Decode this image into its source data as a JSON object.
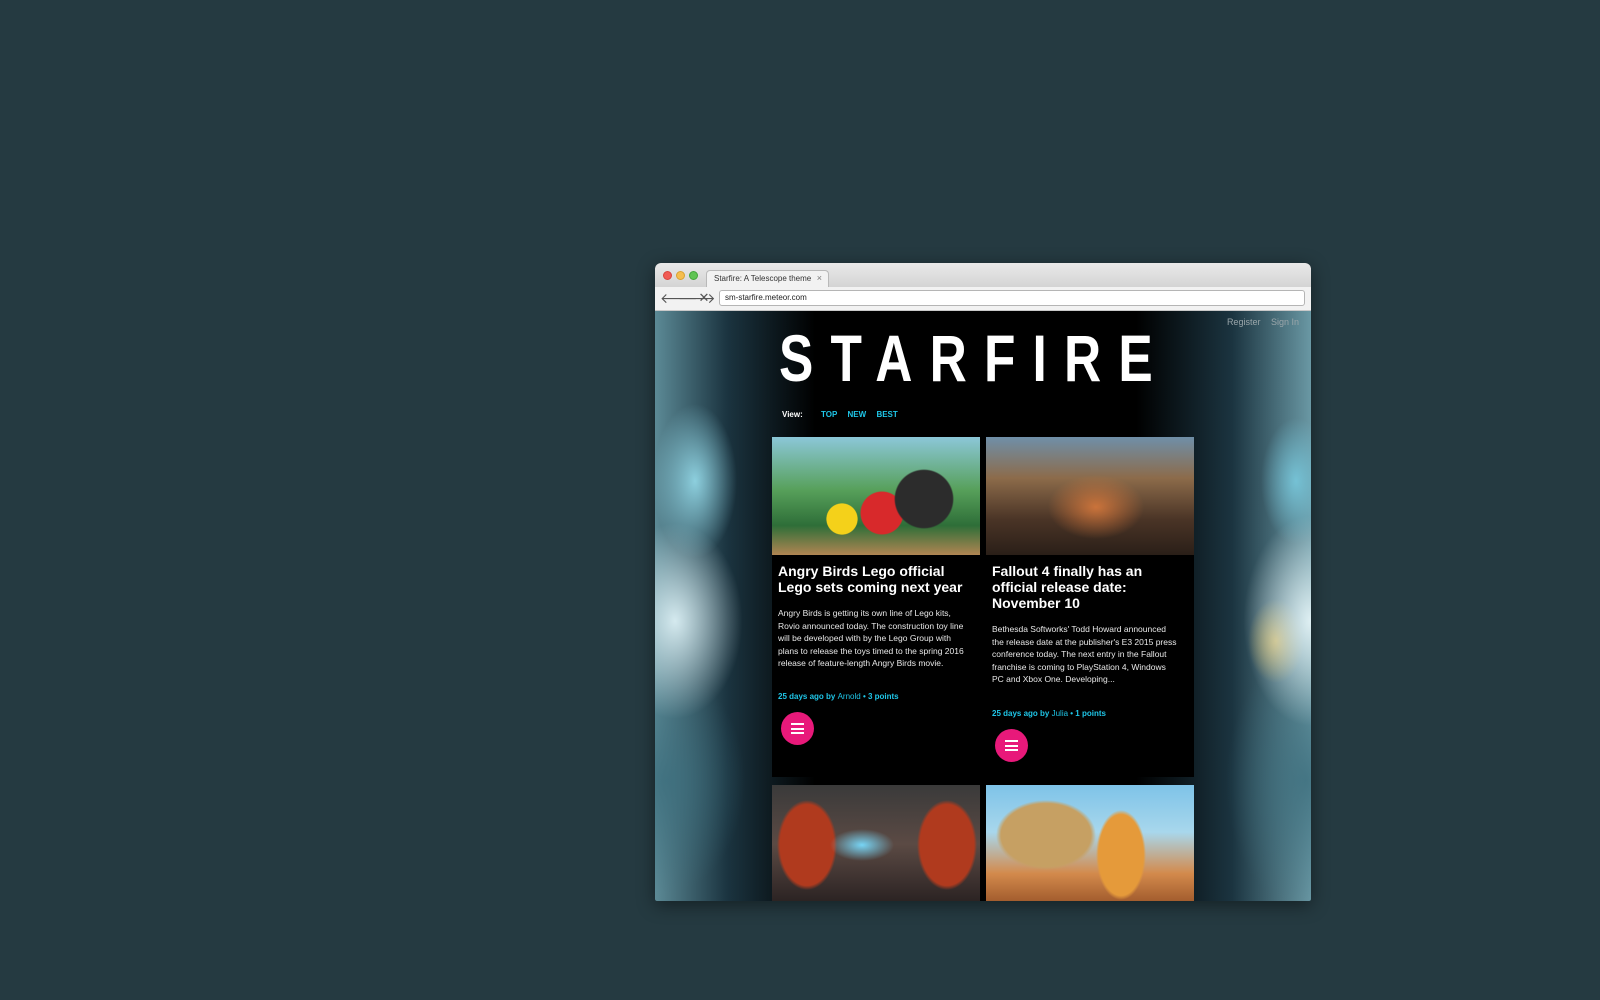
{
  "browser": {
    "tab_title": "Starfire: A Telescope theme",
    "tab_close": "×",
    "url": "sm-starfire.meteor.com",
    "back_icon": "🡐",
    "forward_icon": "🡒",
    "stop_icon": "✕"
  },
  "header": {
    "logo": "STARFIRE",
    "auth": [
      "Register",
      "Sign In"
    ]
  },
  "view": {
    "label": "View:",
    "options": [
      "TOP",
      "NEW",
      "BEST"
    ]
  },
  "posts": [
    {
      "title": "Angry Birds Lego official Lego sets coming next year",
      "excerpt": "Angry Birds is getting its own line of Lego kits, Rovio announced today. The construction toy line will be developed with by the Lego Group with plans to release the toys timed to the spring 2016 release of feature-length Angry Birds movie.",
      "meta_prefix": "25 days ago by ",
      "author": "Arnold",
      "meta_suffix": " • 3 points"
    },
    {
      "title": "Fallout 4 finally has an official release date: November 10",
      "excerpt": "Bethesda Softworks' Todd Howard announced the release date at the publisher's E3 2015 press conference today. The next entry in the Fallout franchise is coming to PlayStation 4, Windows PC and Xbox One. Developing...",
      "meta_prefix": "25 days ago by ",
      "author": "Julia",
      "meta_suffix": " • 1 points"
    }
  ],
  "colors": {
    "background": "#253a41",
    "accent": "#1fc6e8",
    "menu_button": "#e8197a"
  },
  "icons": {
    "menu_button": "hamburger-menu-icon"
  }
}
